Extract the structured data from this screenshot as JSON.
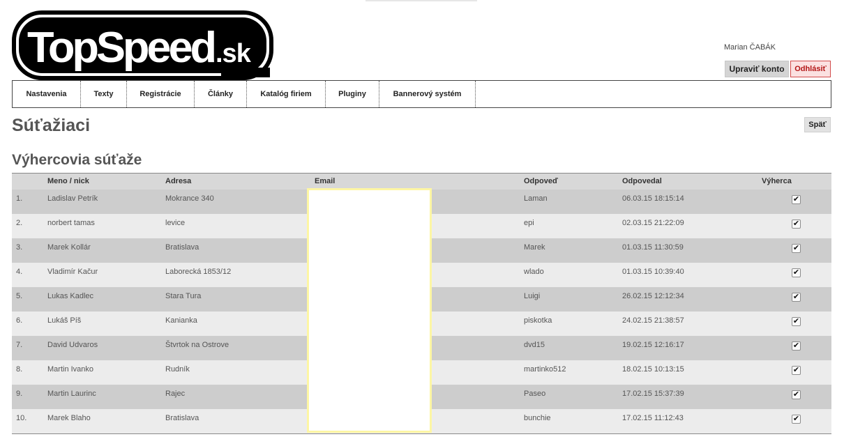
{
  "logo": {
    "text": "TopSpeed",
    "suffix": ".sk"
  },
  "user": {
    "name": "Marian ČABÁK",
    "edit_label": "Upraviť konto",
    "logout_label": "Odhlásiť"
  },
  "nav": [
    {
      "label": "Nastavenia"
    },
    {
      "label": "Texty"
    },
    {
      "label": "Registrácie"
    },
    {
      "label": "Články"
    },
    {
      "label": "Katalóg firiem"
    },
    {
      "label": "Pluginy"
    },
    {
      "label": "Bannerový systém"
    }
  ],
  "page": {
    "title": "Súťažiaci",
    "back_label": "Späť",
    "section_title": "Výhercovia súťaže"
  },
  "table": {
    "headers": {
      "name": "Meno / nick",
      "address": "Adresa",
      "email": "Email",
      "answer": "Odpoveď",
      "answered": "Odpovedal",
      "winner": "Výherca"
    },
    "rows": [
      {
        "num": "1.",
        "name": "Ladislav Petrík",
        "address": "Mokrance 340",
        "answer": "Laman",
        "answered": "06.03.15 18:15:14",
        "winner": true
      },
      {
        "num": "2.",
        "name": "norbert tamas",
        "address": "levice",
        "answer": "epi",
        "answered": "02.03.15 21:22:09",
        "winner": true
      },
      {
        "num": "3.",
        "name": "Marek Kollár",
        "address": "Bratislava",
        "answer": "Marek",
        "answered": "01.03.15 11:30:59",
        "winner": true
      },
      {
        "num": "4.",
        "name": "Vladimír Kačur",
        "address": "Laborecká 1853/12",
        "answer": "wlado",
        "answered": "01.03.15 10:39:40",
        "winner": true
      },
      {
        "num": "5.",
        "name": "Lukas Kadlec",
        "address": "Stara Tura",
        "answer": "Luigi",
        "answered": "26.02.15 12:12:34",
        "winner": true
      },
      {
        "num": "6.",
        "name": "Lukáš Píš",
        "address": "Kanianka",
        "answer": "piskotka",
        "answered": "24.02.15 21:38:57",
        "winner": true
      },
      {
        "num": "7.",
        "name": "David Udvaros",
        "address": "Štvrtok na Ostrove",
        "answer": "dvd15",
        "answered": "19.02.15 12:16:17",
        "winner": true
      },
      {
        "num": "8.",
        "name": "Martin Ivanko",
        "address": "Rudník",
        "answer": "martinko512",
        "answered": "18.02.15 10:13:15",
        "winner": true
      },
      {
        "num": "9.",
        "name": "Martin Laurinc",
        "address": "Rajec",
        "answer": "Paseo",
        "answered": "17.02.15 15:37:39",
        "winner": true
      },
      {
        "num": "10.",
        "name": "Marek Blaho",
        "address": "Bratislava",
        "answer": "bunchie",
        "answered": "17.02.15 11:12:43",
        "winner": true
      }
    ]
  }
}
